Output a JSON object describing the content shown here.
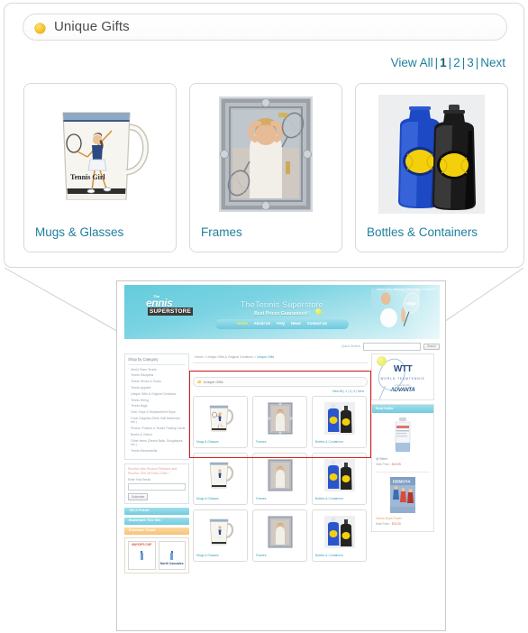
{
  "panel": {
    "header": {
      "icon": "orange-bullet-icon",
      "title": "Unique Gifts"
    },
    "pager": {
      "view_all": "View All",
      "sep": "|",
      "pages": [
        "1",
        "2",
        "3"
      ],
      "current": "1",
      "next": "Next"
    },
    "cards": [
      {
        "label": "Mugs & Glasses",
        "image": "tennis-girl-mug"
      },
      {
        "label": "Frames",
        "image": "tennis-picture-frame"
      },
      {
        "label": "Bottles & Containers",
        "image": "tennis-water-bottles"
      }
    ]
  },
  "thumbnail": {
    "utility_links": "View Cart  |  Sitemap  |  Benefits & Features",
    "logo": {
      "the": "The",
      "name": "ennis",
      "sub": "SUPERSTORE"
    },
    "hero": {
      "title": "TheTennis Superstore",
      "subtitle": "Best Prices Guaranteed !"
    },
    "nav": [
      "Home",
      "About Us",
      "FAQ",
      "News",
      "Contact Us"
    ],
    "nav_active": "Home",
    "search": {
      "label": "Quick Search",
      "value": "",
      "button": "Search"
    },
    "sidebar": {
      "heading": "Shop by Category",
      "categories": [
        "World Team Tennis",
        "Tennis Racquets",
        "Tennis Shoes & Socks",
        "Tennis Apparel",
        "Unique Gifts & Original Creations",
        "Tennis String",
        "Tennis Bags",
        "Over Grips & Replacement Grips",
        "Court Supplies (Nets, Ball Machines, etc.)",
        "Photos, Posters & Tennis Trading Cards",
        "Books & Videos",
        "Other Items (Tennis Balls, Sunglasses, etc.)",
        "Tennis Memorabilia"
      ],
      "newsletter": {
        "pitch": "Receive New Product Releases and Receive 10% off Every Order !",
        "label": "Enter Your Email:",
        "value": "",
        "button": "Subscribe"
      },
      "bars": [
        "Tell A Friend",
        "Bookmark This Site",
        "Purchase Ticket"
      ],
      "tickets": [
        {
          "top": "MAYOR'S CUP",
          "bottom": ""
        },
        {
          "top": "",
          "bottom": "North Cascades"
        }
      ]
    },
    "breadcrumb": {
      "home": "Home",
      "arrow": ">",
      "parent": "Unique Gifts & Original Creations",
      "current": "Unique Gifts"
    },
    "section": {
      "title": "Unique Gifts",
      "pager": "View All | 1 | 2 | 3 | Next"
    },
    "grid_rows": [
      [
        "Mugs & Glasses",
        "Frames",
        "Bottles & Containers"
      ],
      [
        "Mugs & Glasses",
        "Frames",
        "Bottles & Containers"
      ],
      [
        "Mugs & Glasses",
        "Frames",
        "Bottles & Containers"
      ]
    ],
    "right": {
      "wtt": {
        "mark": "WTT",
        "name": "WORLD TEAMTENNIS",
        "presented": "presented by",
        "sponsor": "ADVANTA"
      },
      "best_seller_heading": "Best Seller",
      "items": [
        {
          "name": "@ Relief",
          "price_label": "Sale Price :",
          "price": "$18.95"
        },
        {
          "name": "Carlos Moya Poster",
          "price_label": "Sale Price :",
          "price": "$15.00"
        }
      ]
    }
  },
  "colors": {
    "link": "#1f7f9e",
    "accent": "#fcc82e",
    "highlight": "#e01b1b",
    "hero": "#63ccdd"
  }
}
